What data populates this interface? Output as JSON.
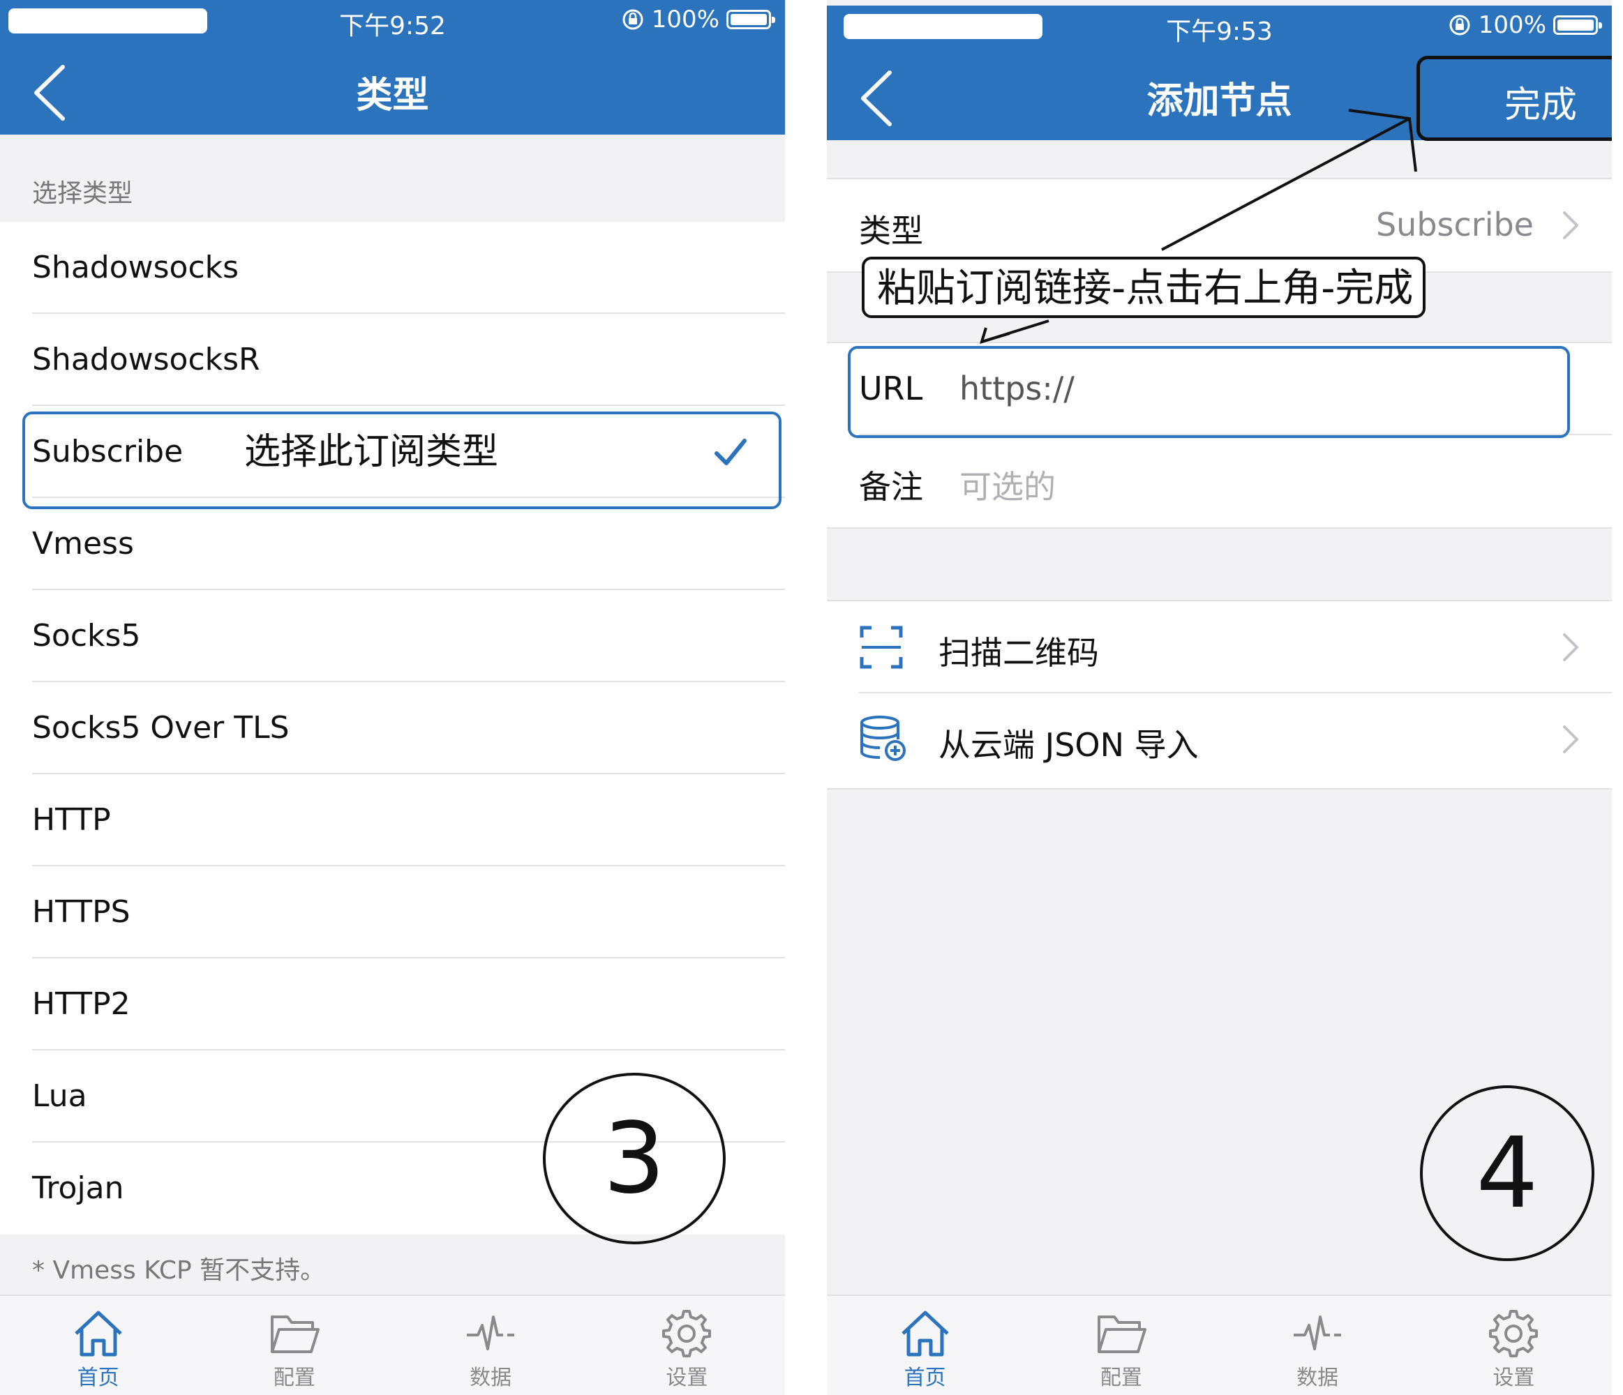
{
  "screen1": {
    "status_time": "下午9:52",
    "status_battery": "100%",
    "title": "类型",
    "section_header": "选择类型",
    "types": [
      "Shadowsocks",
      "ShadowsocksR",
      "Subscribe",
      "Vmess",
      "Socks5",
      "Socks5 Over TLS",
      "HTTP",
      "HTTPS",
      "HTTP2",
      "Lua",
      "Trojan"
    ],
    "selected_type": "Subscribe",
    "annotation": "选择此订阅类型",
    "footer_note": "* Vmess KCP 暂不支持。",
    "step_number": "3"
  },
  "screen2": {
    "status_time": "下午9:53",
    "status_battery": "100%",
    "title": "添加节点",
    "done_label": "完成",
    "type_label": "类型",
    "type_value": "Subscribe",
    "hint": "粘贴订阅链接-点击右上角-完成",
    "url_label": "URL",
    "url_value": "https://",
    "note_label": "备注",
    "note_placeholder": "可选的",
    "scan_label": "扫描二维码",
    "import_label": "从云端 JSON 导入",
    "step_number": "4"
  },
  "tabs": [
    "首页",
    "配置",
    "数据",
    "设置"
  ],
  "colors": {
    "accent": "#2b73bd",
    "background": "#f2f2f4",
    "secondary_text": "#777777",
    "placeholder": "#b0b0b4"
  },
  "icons": {
    "back": "chevron-left-icon",
    "check": "checkmark-icon",
    "chevron": "chevron-right-icon",
    "scan": "qr-scan-icon",
    "import": "cloud-database-icon",
    "tab_home": "home-icon",
    "tab_config": "folder-icon",
    "tab_data": "pulse-icon",
    "tab_settings": "gear-icon"
  }
}
